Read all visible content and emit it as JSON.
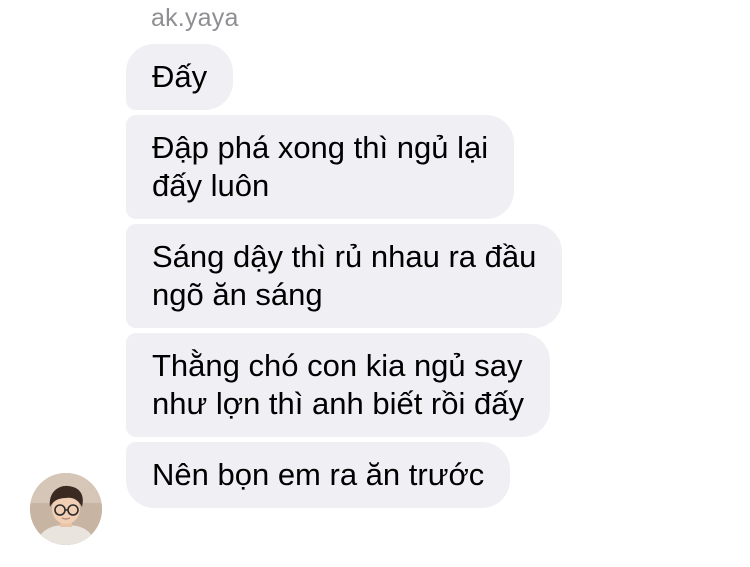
{
  "thread": {
    "sender_name": "ak.yaya",
    "messages": [
      "Đấy",
      "Đập phá xong thì ngủ lại\nđấy luôn",
      "Sáng dậy thì rủ nhau ra đầu\nngõ ăn sáng",
      "Thằng chó con kia ngủ say\nnhư lợn thì anh biết rồi đấy",
      "Nên bọn em ra ăn trước"
    ]
  },
  "colors": {
    "bubble_bg": "#efeff4",
    "sender_text": "#8e8e93",
    "message_text": "#000000"
  },
  "icons": {
    "avatar": "user-avatar-photo"
  }
}
